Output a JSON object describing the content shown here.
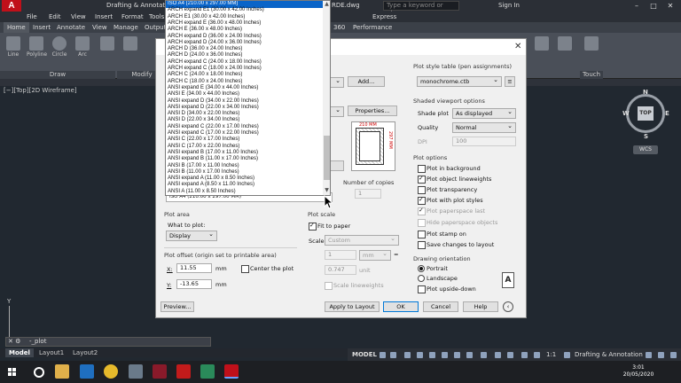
{
  "app": {
    "workspace": "Drafting & Annotati",
    "document": "RDE.dwg",
    "search_placeholder": "Type a keyword or phrase",
    "sign_in": "Sign In"
  },
  "menu": [
    "File",
    "Edit",
    "View",
    "Insert",
    "Format",
    "Tools",
    "Express"
  ],
  "ribbon_tabs": [
    "Home",
    "Insert",
    "Annotate",
    "View",
    "Manage",
    "Output",
    "360",
    "Performance"
  ],
  "ribbon_tools": [
    "Line",
    "Polyline",
    "Circle",
    "Arc"
  ],
  "ribbon_panels": {
    "draw": "Draw",
    "modify": "Modify",
    "touch": "Touch"
  },
  "viewport_label": "[−][Top][2D Wireframe]",
  "viewcube": {
    "n": "N",
    "s": "S",
    "e": "E",
    "w": "W",
    "top": "TOP",
    "wcs": "WCS"
  },
  "command_line": "-_plot",
  "ucs_label": "Y",
  "layout_tabs": [
    "Model",
    "Layout1",
    "Layout2"
  ],
  "status": {
    "model": "MODEL",
    "scale": "1:1",
    "workspace": "Drafting & Annotation"
  },
  "clock": {
    "time": "3:01",
    "date": "20/05/2020"
  },
  "plot_dialog": {
    "add_button": "Add...",
    "properties_button": "Properties...",
    "plot_style_table": {
      "label": "Plot style table (pen assignments)",
      "value": "monochrome.ctb"
    },
    "shaded_viewport": {
      "label": "Shaded viewport options",
      "shade_plot_label": "Shade plot",
      "shade_plot_value": "As displayed",
      "quality_label": "Quality",
      "quality_value": "Normal",
      "dpi_label": "DPI",
      "dpi_value": "100"
    },
    "plot_options": {
      "label": "Plot options",
      "items": [
        {
          "label": "Plot in background",
          "checked": false,
          "disabled": false
        },
        {
          "label": "Plot object lineweights",
          "checked": true,
          "disabled": false
        },
        {
          "label": "Plot transparency",
          "checked": false,
          "disabled": false
        },
        {
          "label": "Plot with plot styles",
          "checked": true,
          "disabled": false
        },
        {
          "label": "Plot paperspace last",
          "checked": true,
          "disabled": true
        },
        {
          "label": "Hide paperspace objects",
          "checked": false,
          "disabled": true
        },
        {
          "label": "Plot stamp on",
          "checked": false,
          "disabled": false
        },
        {
          "label": "Save changes to layout",
          "checked": false,
          "disabled": false
        }
      ]
    },
    "drawing_orientation": {
      "label": "Drawing orientation",
      "portrait": "Portrait",
      "landscape": "Landscape",
      "upside_down": "Plot upside-down",
      "selected": "portrait"
    },
    "preview_dims": {
      "width": "210 MM",
      "height": "297 MM"
    },
    "copies": {
      "label": "Number of copies",
      "value": "1"
    },
    "paper_size_value": "ISO A4 (210.00 x 297.00 MM)",
    "plot_area": {
      "label": "Plot area",
      "what_label": "What to plot:",
      "what_value": "Display"
    },
    "plot_offset": {
      "label": "Plot offset (origin set to printable area)",
      "x_label": "X:",
      "x_value": "11.55",
      "y_label": "Y:",
      "y_value": "-13.65",
      "unit": "mm",
      "center": "Center the plot"
    },
    "plot_scale": {
      "label": "Plot scale",
      "fit": "Fit to paper",
      "scale_label": "Scale:",
      "scale_value": "Custom",
      "num_value": "1",
      "unit_value": "mm",
      "eq": "=",
      "units_value": "0.747",
      "units_label": "unit",
      "lineweights": "Scale lineweights"
    },
    "buttons": {
      "preview": "Preview...",
      "apply": "Apply to Layout",
      "ok": "OK",
      "cancel": "Cancel",
      "help": "Help"
    }
  },
  "paper_sizes": [
    "ISO A4 (210.00 x 297.00 MM)",
    "ARCH expand E1 (30.00 x 42.00 Inches)",
    "ARCH E1 (30.00 x 42.00 Inches)",
    "ARCH expand E (36.00 x 48.00 Inches)",
    "ARCH E (36.00 x 48.00 Inches)",
    "ARCH expand D (36.00 x 24.00 Inches)",
    "ARCH expand D (24.00 x 36.00 Inches)",
    "ARCH D (36.00 x 24.00 Inches)",
    "ARCH D (24.00 x 36.00 Inches)",
    "ARCH expand C (24.00 x 18.00 Inches)",
    "ARCH expand C (18.00 x 24.00 Inches)",
    "ARCH C (24.00 x 18.00 Inches)",
    "ARCH C (18.00 x 24.00 Inches)",
    "ANSI expand E (34.00 x 44.00 Inches)",
    "ANSI E (34.00 x 44.00 Inches)",
    "ANSI expand D (34.00 x 22.00 Inches)",
    "ANSI expand D (22.00 x 34.00 Inches)",
    "ANSI D (34.00 x 22.00 Inches)",
    "ANSI D (22.00 x 34.00 Inches)",
    "ANSI expand C (22.00 x 17.00 Inches)",
    "ANSI expand C (17.00 x 22.00 Inches)",
    "ANSI C (22.00 x 17.00 Inches)",
    "ANSI C (17.00 x 22.00 Inches)",
    "ANSI expand B (17.00 x 11.00 Inches)",
    "ANSI expand B (11.00 x 17.00 Inches)",
    "ANSI B (17.00 x 11.00 Inches)",
    "ANSI B (11.00 x 17.00 Inches)",
    "ANSI expand A (11.00 x 8.50 Inches)",
    "ANSI expand A (8.50 x 11.00 Inches)",
    "ANSI A (11.00 x 8.50 Inches)"
  ],
  "colors": {
    "accent": "#0a64c8",
    "autocad_red": "#c0101a"
  }
}
